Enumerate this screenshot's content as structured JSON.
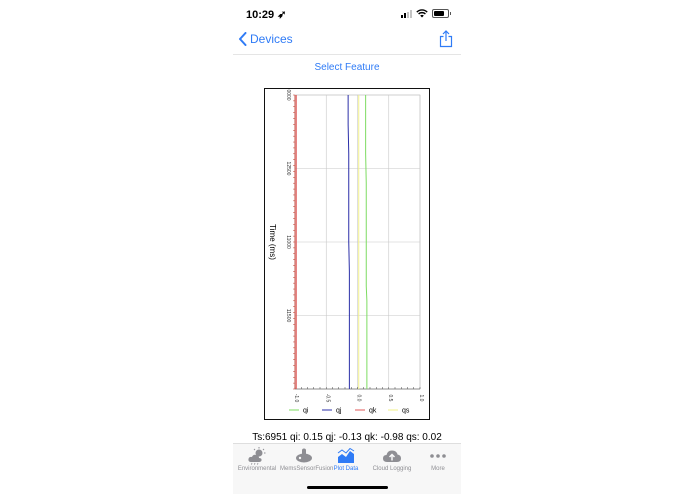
{
  "status_bar": {
    "time": "10:29 ➶"
  },
  "nav": {
    "back_label": "Devices"
  },
  "select_feature": "Select Feature",
  "readout": "Ts:6951 qi:  0.15 qj: -0.13 qk: -0.98 qs:  0.02",
  "tabs": [
    {
      "label": "Environmental",
      "icon": "cloud-sun-icon",
      "active": false
    },
    {
      "label": "Mems",
      "icon": "mems-icon",
      "active": false
    },
    {
      "label": "SensorFusion",
      "icon": "sensor-fusion-icon",
      "active": false
    },
    {
      "label": "Plot Data",
      "icon": "chart-area-icon",
      "active": true
    },
    {
      "label": "Cloud Logging",
      "icon": "cloud-upload-icon",
      "active": false
    },
    {
      "label": "More",
      "icon": "more-icon",
      "active": false
    }
  ],
  "colors": {
    "accent": "#2f7bf6",
    "qi": "#7ddc62",
    "qj": "#2b2fa8",
    "qk": "#e05a5a",
    "qs": "#f2f08a"
  },
  "chart_data": {
    "type": "line",
    "orientation": "rotated",
    "ylabel": "Time (ms)",
    "xlim": [
      -1.0,
      1.0
    ],
    "x_ticks": [
      "-1.0",
      "-0.5",
      "0.0",
      "0.5",
      "1.0"
    ],
    "time_range": [
      0,
      10000
    ],
    "time_ticks": [
      "0000",
      "12500",
      "11000",
      "11500"
    ],
    "grid": true,
    "legend": "bottom",
    "series": [
      {
        "name": "qi",
        "color": "#7ddc62",
        "t": [
          0,
          1000,
          2000,
          3000,
          4000,
          5000,
          6000,
          6500,
          7000,
          8000,
          9000,
          10000
        ],
        "v": [
          0.13,
          0.13,
          0.13,
          0.14,
          0.14,
          0.14,
          0.14,
          0.14,
          0.15,
          0.15,
          0.15,
          0.15
        ]
      },
      {
        "name": "qj",
        "color": "#2b2fa8",
        "t": [
          0,
          1000,
          2000,
          3000,
          4000,
          5000,
          6000,
          7000,
          8000,
          9000,
          10000
        ],
        "v": [
          -0.15,
          -0.15,
          -0.14,
          -0.14,
          -0.14,
          -0.14,
          -0.13,
          -0.13,
          -0.13,
          -0.13,
          -0.13
        ]
      },
      {
        "name": "qk",
        "color": "#e05a5a",
        "t": [
          0,
          2000,
          4000,
          6000,
          8000,
          10000
        ],
        "v": [
          -0.98,
          -0.98,
          -0.98,
          -0.98,
          -0.98,
          -0.98
        ]
      },
      {
        "name": "qs",
        "color": "#f2f08a",
        "t": [
          0,
          2000,
          4000,
          6000,
          8000,
          10000
        ],
        "v": [
          0.02,
          0.02,
          0.02,
          0.02,
          0.02,
          0.02
        ]
      }
    ]
  }
}
